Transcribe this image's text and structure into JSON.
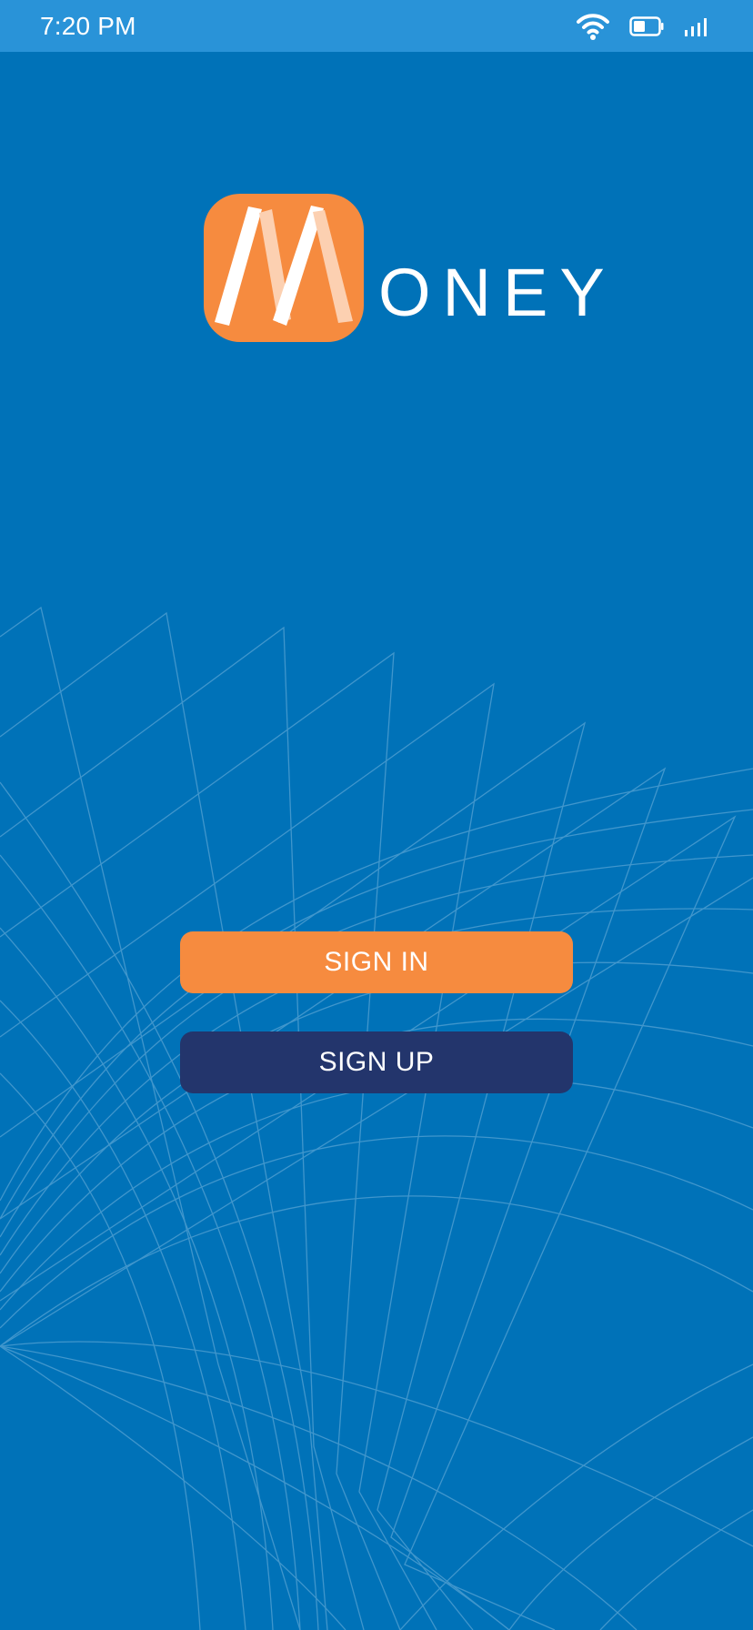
{
  "status_bar": {
    "time": "7:20 PM",
    "icons": [
      "wifi-icon",
      "battery-icon",
      "signal-icon"
    ]
  },
  "logo": {
    "mark_letter": "M",
    "text": "ONEY"
  },
  "buttons": {
    "sign_in": "SIGN IN",
    "sign_up": "SIGN UP"
  },
  "colors": {
    "background": "#0072b8",
    "status_bar": "#2993d8",
    "logo_orange": "#f68b3f",
    "sign_in_button": "#f68b3f",
    "sign_up_button": "#23356c",
    "text": "#ffffff"
  }
}
